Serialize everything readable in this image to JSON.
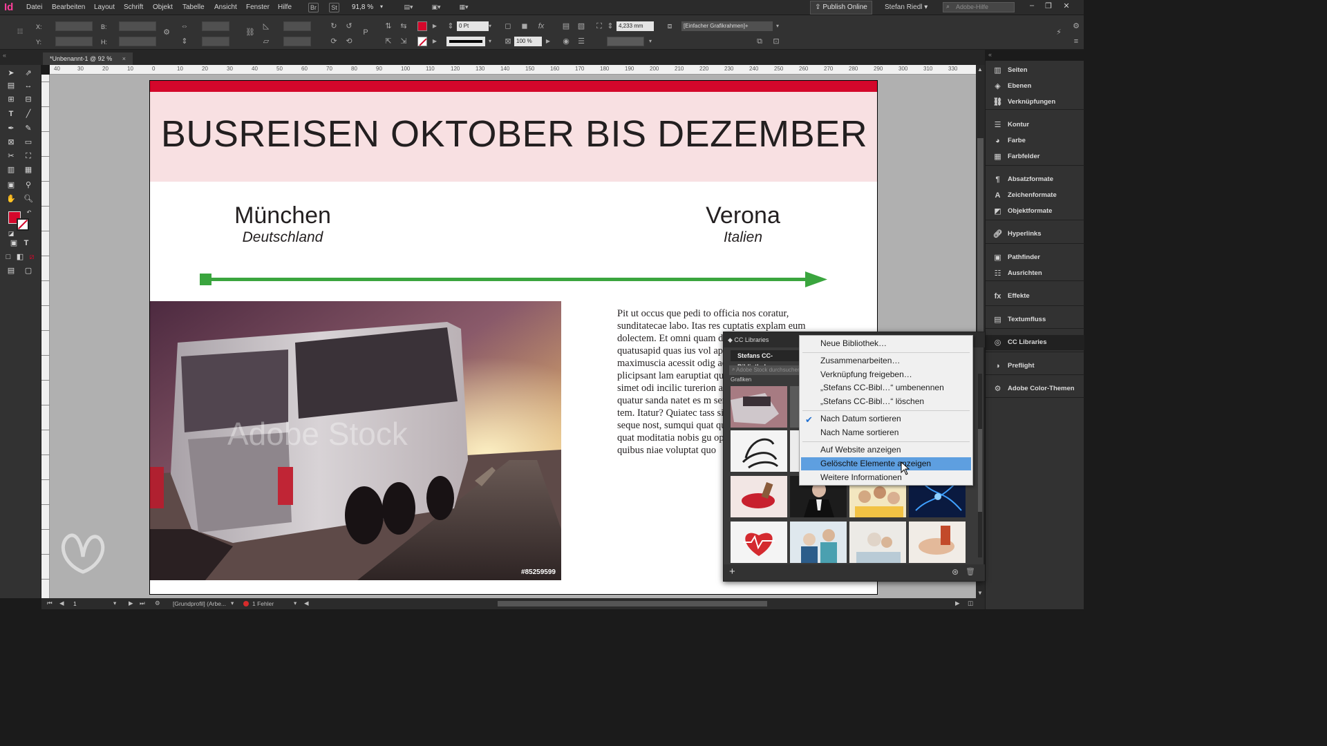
{
  "app": {
    "logo": "Id",
    "menu": [
      "Datei",
      "Bearbeiten",
      "Layout",
      "Schrift",
      "Objekt",
      "Tabelle",
      "Ansicht",
      "Fenster",
      "Hilfe"
    ],
    "bridge_label": "Br",
    "stock_label": "St",
    "zoom": "91,8 %",
    "publish_label": "Publish Online",
    "user_name": "Stefan Riedl",
    "help_placeholder": "Adobe-Hilfe"
  },
  "control": {
    "x_label": "X:",
    "y_label": "Y:",
    "w_label": "B:",
    "h_label": "H:",
    "stroke_weight": "0 Pt",
    "scale": "100 %",
    "frame_size": "4,233 mm",
    "frame_style": "[Einfacher Grafikrahmen]+"
  },
  "tab": {
    "title": "*Unbenannt-1 @ 92 %",
    "close": "×"
  },
  "ruler": {
    "top_ticks": [
      "40",
      "30",
      "20",
      "10",
      "0",
      "10",
      "20",
      "30",
      "40",
      "50",
      "60",
      "70",
      "80",
      "90",
      "100",
      "110",
      "120",
      "130",
      "140",
      "150",
      "160",
      "170",
      "180",
      "190",
      "200",
      "210",
      "220",
      "230",
      "240",
      "250",
      "260",
      "270",
      "280",
      "290",
      "300",
      "310",
      "330"
    ]
  },
  "document": {
    "headline": "BUSREISEN OKTOBER BIS DEZEMBER",
    "origin_city": "München",
    "origin_country": "Deutschland",
    "dest_city": "Verona",
    "dest_country": "Italien",
    "body": "Pit ut occus que pedi to officia nos coratur, sunditatecae labo. Itas res cuptatis explam eum dolectem. Et omni quam doluptae asi dolor quatusapid quas ius vol apitiaectur sam repelen maximuscia acessit odig acilitae eossimp orendis plicipsant lam earuptiat quundae neceate pratem simet odi incilic turerion accustiorro moluptatam quatur sanda natet es m sercitaque necum conse tem. Itatur? Quiatec tass sitis ut ute nihil isque nin seque nost, sumqui quat quo inusae nitam, Iomni quat moditatia nobis gu optatibeate vollabo ratis quibus niae voluptat quo",
    "photo_watermark": "Adobe Stock",
    "photo_id": "#85259599",
    "accent_red": "#d4072b",
    "header_pink": "#f8e0e2",
    "arrow_green": "#3aa53e"
  },
  "status": {
    "page": "1",
    "profile": "[Grundprofil] (Arbe...",
    "errors": "1 Fehler"
  },
  "panels": [
    {
      "label": "Seiten",
      "icon": "pages-icon"
    },
    {
      "label": "Ebenen",
      "icon": "layers-icon"
    },
    {
      "label": "Verknüpfungen",
      "icon": "links-icon"
    },
    {
      "label": "Kontur",
      "icon": "stroke-icon"
    },
    {
      "label": "Farbe",
      "icon": "color-icon"
    },
    {
      "label": "Farbfelder",
      "icon": "swatches-icon"
    },
    {
      "label": "Absatzformate",
      "icon": "paragraph-styles-icon"
    },
    {
      "label": "Zeichenformate",
      "icon": "character-styles-icon"
    },
    {
      "label": "Objektformate",
      "icon": "object-styles-icon"
    },
    {
      "label": "Hyperlinks",
      "icon": "hyperlinks-icon"
    },
    {
      "label": "Pathfinder",
      "icon": "pathfinder-icon"
    },
    {
      "label": "Ausrichten",
      "icon": "align-icon"
    },
    {
      "label": "Effekte",
      "icon": "effects-icon"
    },
    {
      "label": "Textumfluss",
      "icon": "text-wrap-icon"
    },
    {
      "label": "CC Libraries",
      "icon": "cc-libraries-icon"
    },
    {
      "label": "Preflight",
      "icon": "preflight-icon"
    },
    {
      "label": "Adobe Color-Themen",
      "icon": "color-themes-icon"
    }
  ],
  "cc_panel": {
    "title": "CC Libraries",
    "library_name": "Stefans CC-Bibliothek",
    "search_placeholder": "Adobe Stock durchsuchen",
    "section": "Grafiken"
  },
  "context_menu": {
    "items": [
      {
        "label": "Neue Bibliothek…"
      },
      {
        "label": "Zusammenarbeiten…"
      },
      {
        "label": "Verknüpfung freigeben…"
      },
      {
        "label": "„Stefans CC-Bibl…“ umbenennen"
      },
      {
        "label": "„Stefans CC-Bibl…“ löschen"
      },
      {
        "label": "Nach Datum sortieren",
        "checked": true
      },
      {
        "label": "Nach Name sortieren"
      },
      {
        "label": "Auf Website anzeigen"
      },
      {
        "label": "Gelöschte Elemente anzeigen",
        "highlighted": true
      },
      {
        "label": "Weitere Informationen"
      }
    ]
  }
}
